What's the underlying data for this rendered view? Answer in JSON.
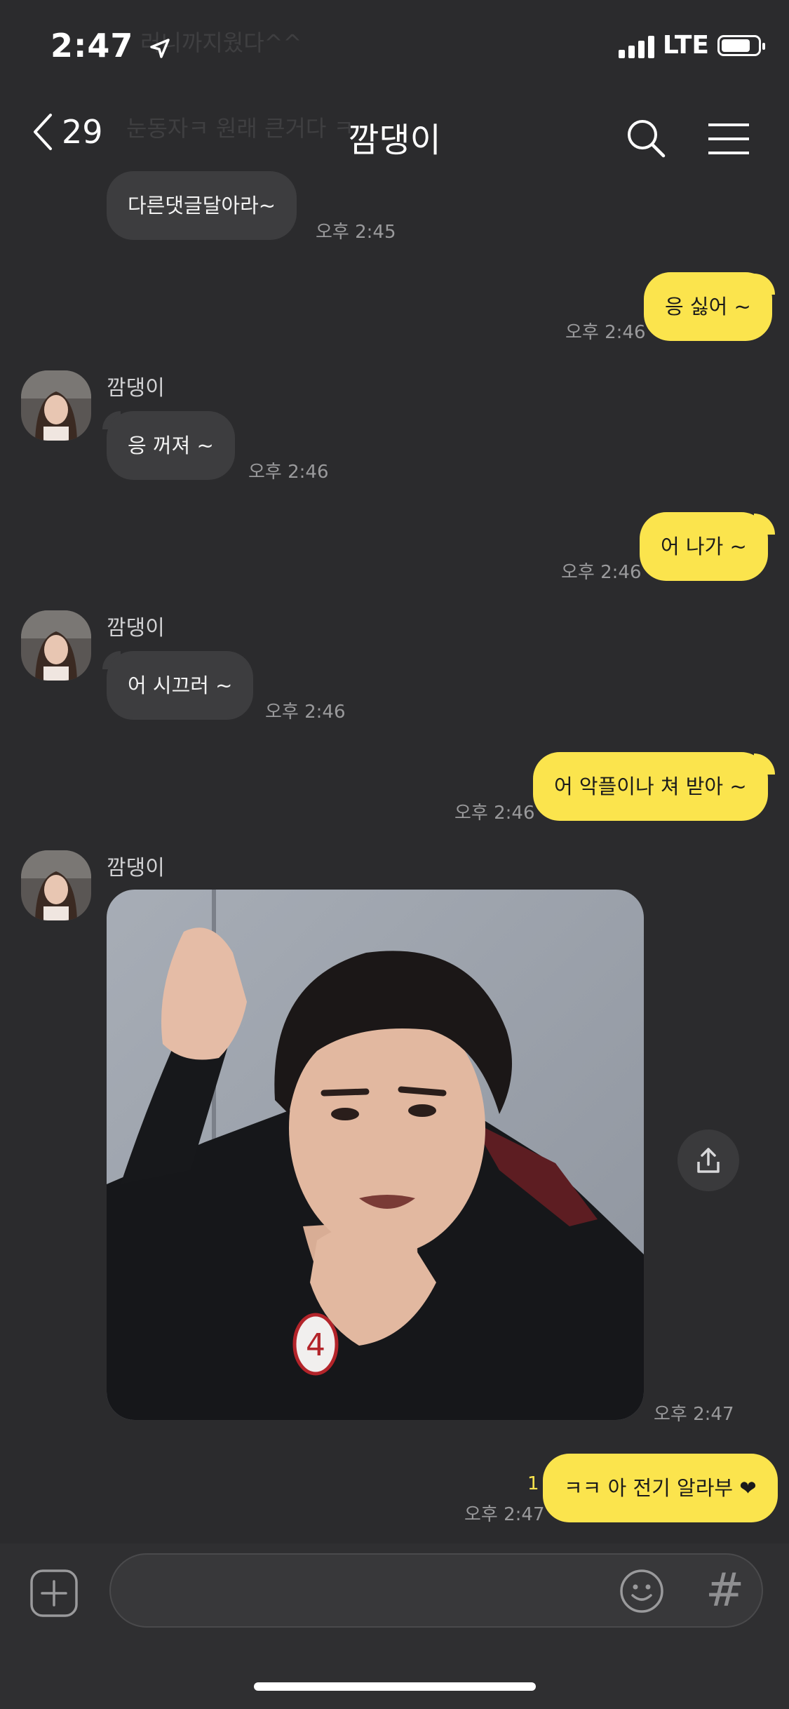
{
  "status": {
    "time": "2:47",
    "network": "LTE"
  },
  "header": {
    "back_count": "29",
    "title": "깜댕이"
  },
  "background_ghost": {
    "line1": "러니까지웠다^^",
    "line2": "눈동자ㅋ 원래 큰거다 ㅋ"
  },
  "messages": [
    {
      "dir": "in",
      "text": "다른댓글달아라~",
      "time": "오후 2:45"
    },
    {
      "dir": "out",
      "text": "응 싫어 ~",
      "time": "오후 2:46"
    },
    {
      "dir": "in",
      "sender": "깜댕이",
      "text": "응 꺼져 ~",
      "time": "오후 2:46"
    },
    {
      "dir": "out",
      "text": "어 나가 ~",
      "time": "오후 2:46"
    },
    {
      "dir": "in",
      "sender": "깜댕이",
      "text": "어 시끄러 ~",
      "time": "오후 2:46"
    },
    {
      "dir": "out",
      "text": "어 악플이나 쳐 받아 ~",
      "time": "오후 2:46"
    },
    {
      "dir": "in",
      "sender": "깜댕이",
      "type": "image",
      "time": "오후 2:47",
      "jersey_number": "4"
    },
    {
      "dir": "out",
      "text": "ㅋㅋ 아 전기 알라부 ❤",
      "time": "오후 2:47",
      "unread": "1"
    }
  ],
  "icons": [
    "back-chevron-icon",
    "search-icon",
    "menu-icon",
    "share-icon",
    "plus-icon",
    "emoji-icon",
    "hashtag-icon"
  ],
  "colors": {
    "background": "#2b2b2d",
    "incoming_bubble": "#3d3d3f",
    "outgoing_bubble": "#fbe44d",
    "time_text": "#9a9a9c"
  }
}
